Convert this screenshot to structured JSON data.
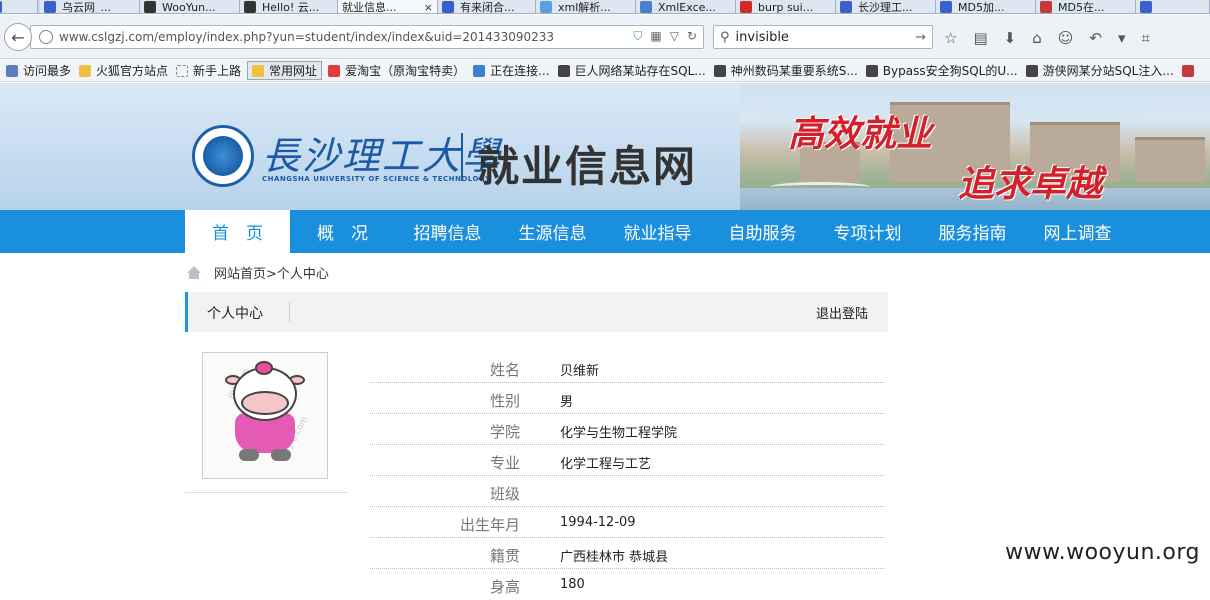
{
  "tabs": [
    {
      "label": "乌云网_...",
      "color": "#3b5fcf",
      "active": false
    },
    {
      "label": "WooYun...",
      "color": "#333333",
      "active": false
    },
    {
      "label": "Hello! 云...",
      "color": "#333333",
      "active": false
    },
    {
      "label": "就业信息...",
      "color": "#ffffff",
      "active": true
    },
    {
      "label": "有来闭合...",
      "color": "#3b5fcf",
      "active": false
    },
    {
      "label": "xml解析...",
      "color": "#5aa0e0",
      "active": false
    },
    {
      "label": "XmlExce...",
      "color": "#4a7fd0",
      "active": false
    },
    {
      "label": "burp sui...",
      "color": "#d42a2a",
      "active": false
    },
    {
      "label": "长沙理工...",
      "color": "#3b5fcf",
      "active": false
    },
    {
      "label": "MD5加...",
      "color": "#3b5fcf",
      "active": false
    },
    {
      "label": "MD5在...",
      "color": "#c43a3a",
      "active": false
    }
  ],
  "tab_close": "×",
  "address": {
    "url": "www.cslgzj.com/employ/index.php?yun=student/index/index&uid=201433090233"
  },
  "search": {
    "value": "invisible"
  },
  "bookmarks": [
    {
      "label": "访问最多",
      "color": "#5b7fbf"
    },
    {
      "label": "火狐官方站点",
      "color": "#f0c040"
    },
    {
      "label": "新手上路",
      "color": "#dddddd"
    },
    {
      "label": "常用网址",
      "color": "#f0c040"
    },
    {
      "label": "爱淘宝（原淘宝特卖）",
      "color": "#e33a3a"
    },
    {
      "label": "正在连接...",
      "color": "#3a7fd0"
    },
    {
      "label": "巨人网络某站存在SQL...",
      "color": "#444444"
    },
    {
      "label": "神州数码某重要系统S...",
      "color": "#444444"
    },
    {
      "label": "Bypass安全狗SQL的U...",
      "color": "#444444"
    },
    {
      "label": "游侠网某分站SQL注入...",
      "color": "#444444"
    }
  ],
  "header": {
    "university_name": "長沙理工大學",
    "university_en": "CHANGSHA UNIVERSITY OF SCIENCE & TECHNOLOGY",
    "site_title": "就业信息网",
    "slogan_1": "高效就业",
    "slogan_2": "追求卓越"
  },
  "nav": [
    "首　页",
    "概　况",
    "招聘信息",
    "生源信息",
    "就业指导",
    "自助服务",
    "专项计划",
    "服务指南",
    "网上调查"
  ],
  "breadcrumb": "网站首页>个人中心",
  "panel": {
    "title": "个人中心",
    "logout": "退出登陆"
  },
  "avatar_watermark": "JRJ.com",
  "profile": [
    {
      "label": "姓名",
      "value": "贝维新"
    },
    {
      "label": "性别",
      "value": "男"
    },
    {
      "label": "学院",
      "value": "化学与生物工程学院"
    },
    {
      "label": "专业",
      "value": "化学工程与工艺"
    },
    {
      "label": "班级",
      "value": ""
    },
    {
      "label": "出生年月",
      "value": "1994-12-09"
    },
    {
      "label": "籍贯",
      "value": "广西桂林市 恭城县"
    },
    {
      "label": "身高",
      "value": "180"
    }
  ],
  "watermark": "www.wooyun.org",
  "colors": {
    "nav_blue": "#1a8fde",
    "slogan_red": "#d4202a",
    "brand_blue": "#1d5aa6"
  }
}
